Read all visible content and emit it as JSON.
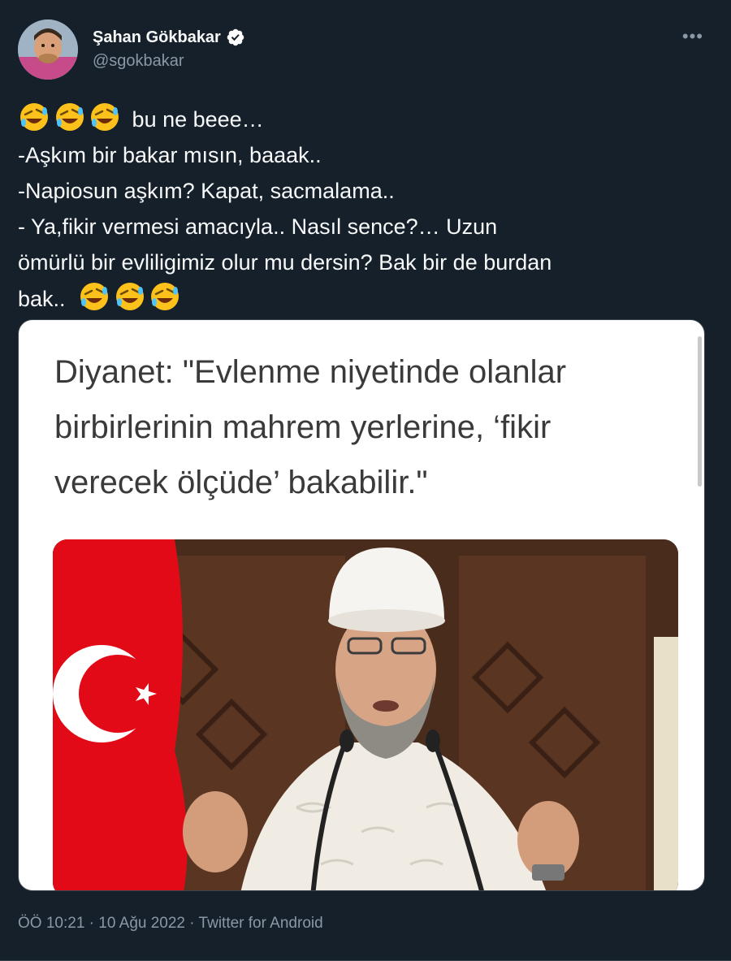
{
  "author": {
    "display_name": "Şahan Gökbakar",
    "handle": "@sgokbakar",
    "verified": true,
    "avatar_icon": "profile-avatar"
  },
  "menu": {
    "more_label": "•••",
    "icon": "more-horizontal-icon"
  },
  "tweet": {
    "lines": [
      "bu ne beee…",
      "-Aşkım bir bakar mısın, baaak..",
      "-Napiosun aşkım? Kapat, sacmalama..",
      "- Ya,fikir vermesi amacıyla.. Nasıl sence?… Uzun",
      "ömürlü bir evliligimiz olur mu dersin? Bak bir de burdan",
      "bak.."
    ],
    "emoji": "rolling-on-floor-laughing-emoji"
  },
  "media": {
    "quote_lines": [
      "Diyanet: \"Evlenme niyetinde olanlar",
      "birbirlerinin mahrem yerlerine, ‘fikir",
      "verecek ölçüde’ bakabilir.\""
    ],
    "photo": "man-in-white-turban-at-podium-with-turkish-flag"
  },
  "meta": {
    "time": "ÖÖ 10:21",
    "date": "10 Ağu 2022",
    "source": "Twitter for Android",
    "separator": "·"
  },
  "colors": {
    "background": "#15202b",
    "text": "#f7f9f9",
    "secondary": "#8b98a5",
    "verified": "#ffffff",
    "flag_red": "#e30a17"
  }
}
